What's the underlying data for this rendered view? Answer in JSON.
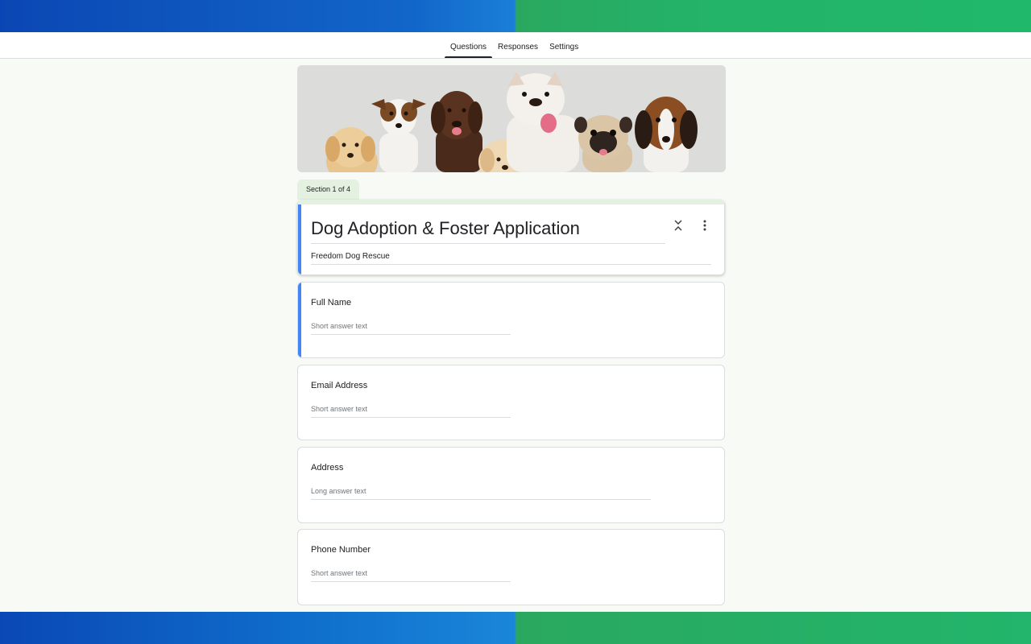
{
  "tabs": [
    {
      "label": "Questions",
      "active": true
    },
    {
      "label": "Responses",
      "active": false
    },
    {
      "label": "Settings",
      "active": false
    }
  ],
  "section_label": "Section 1 of 4",
  "form": {
    "title": "Dog Adoption & Foster Application",
    "description": "Freedom Dog Rescue"
  },
  "questions": [
    {
      "title": "Full Name",
      "placeholder": "Short answer text"
    },
    {
      "title": "Email Address",
      "placeholder": "Short answer text"
    },
    {
      "title": "Address",
      "placeholder": "Long answer text"
    },
    {
      "title": "Phone Number",
      "placeholder": "Short answer text"
    }
  ],
  "icons": {
    "collapse": "collapse-section-icon",
    "more": "more-vert-icon"
  },
  "colors": {
    "accent": "#4285f4",
    "section_tab": "#e4f1e1"
  }
}
